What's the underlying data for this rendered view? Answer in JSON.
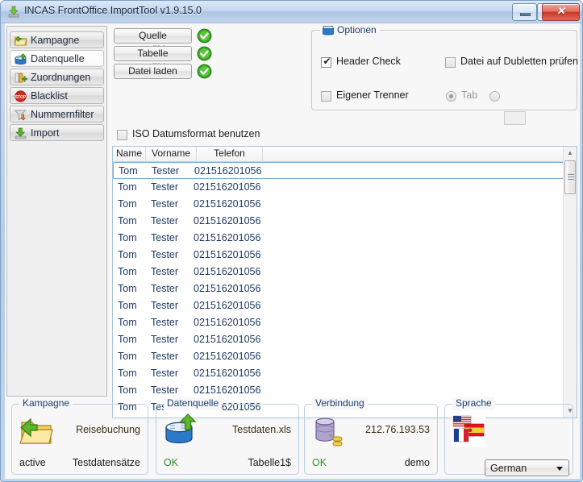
{
  "window": {
    "title": "INCAS FrontOffice ImportTool v1.9.15.0",
    "icon": "import-arrow-icon",
    "minimize_label": "",
    "maximize_label": "",
    "close_label": "✕"
  },
  "sidebar": {
    "items": [
      {
        "label": "Kampagne",
        "icon": "folder-arrow-icon",
        "selected": false
      },
      {
        "label": "Datenquelle",
        "icon": "database-arrow-icon",
        "selected": true
      },
      {
        "label": "Zuordnungen",
        "icon": "columns-plus-icon",
        "selected": false
      },
      {
        "label": "Blacklist",
        "icon": "stop-sign-icon",
        "selected": false
      },
      {
        "label": "Nummernfilter",
        "icon": "funnel-arrow-icon",
        "selected": false
      },
      {
        "label": "Import",
        "icon": "download-arrow-icon",
        "selected": false
      }
    ]
  },
  "toolbar": {
    "buttons": [
      {
        "label": "Quelle auswählen",
        "status_icon": "green-check-icon"
      },
      {
        "label": "Tabelle auswählen",
        "status_icon": "green-check-icon"
      },
      {
        "label": "Datei laden",
        "status_icon": "green-check-icon"
      }
    ]
  },
  "options": {
    "title": "Optionen",
    "icon": "options-box-icon",
    "header_check": {
      "label": "Header Check",
      "checked": true,
      "mark": "✔"
    },
    "duplicates_check": {
      "label": "Datei auf Dubletten prüfen",
      "checked": false
    },
    "own_separator": {
      "label": "Eigener Trenner",
      "checked": false
    },
    "separator_tab": {
      "label": "Tab",
      "selected": true
    },
    "separator_custom": {
      "label": "",
      "selected": false,
      "value": ""
    }
  },
  "iso_date": {
    "label": "ISO Datumsformat benutzen",
    "checked": false
  },
  "grid": {
    "columns": [
      {
        "label": "Name"
      },
      {
        "label": "Vorname"
      },
      {
        "label": "Telefon"
      },
      {
        "label": ""
      }
    ],
    "rows": [
      {
        "name": "Tom",
        "vorname": "Tester",
        "telefon": "021516201056",
        "selected": true
      },
      {
        "name": "Tom",
        "vorname": "Tester",
        "telefon": "021516201056",
        "selected": false
      },
      {
        "name": "Tom",
        "vorname": "Tester",
        "telefon": "021516201056",
        "selected": false
      },
      {
        "name": "Tom",
        "vorname": "Tester",
        "telefon": "021516201056",
        "selected": false
      },
      {
        "name": "Tom",
        "vorname": "Tester",
        "telefon": "021516201056",
        "selected": false
      },
      {
        "name": "Tom",
        "vorname": "Tester",
        "telefon": "021516201056",
        "selected": false
      },
      {
        "name": "Tom",
        "vorname": "Tester",
        "telefon": "021516201056",
        "selected": false
      },
      {
        "name": "Tom",
        "vorname": "Tester",
        "telefon": "021516201056",
        "selected": false
      },
      {
        "name": "Tom",
        "vorname": "Tester",
        "telefon": "021516201056",
        "selected": false
      },
      {
        "name": "Tom",
        "vorname": "Tester",
        "telefon": "021516201056",
        "selected": false
      },
      {
        "name": "Tom",
        "vorname": "Tester",
        "telefon": "021516201056",
        "selected": false
      },
      {
        "name": "Tom",
        "vorname": "Tester",
        "telefon": "021516201056",
        "selected": false
      },
      {
        "name": "Tom",
        "vorname": "Tester",
        "telefon": "021516201056",
        "selected": false
      },
      {
        "name": "Tom",
        "vorname": "Tester",
        "telefon": "021516201056",
        "selected": false
      },
      {
        "name": "Tom",
        "vorname": "Tester",
        "telefon": "021516201056",
        "selected": false
      }
    ],
    "scrollbar": {
      "up_glyph": "▲",
      "down_glyph": "▼"
    }
  },
  "status": {
    "kampagne": {
      "title": "Kampagne",
      "icon": "folder-arrow-icon",
      "name": "Reisebuchung",
      "state": "active",
      "detail": "Testdatensätze"
    },
    "datenquelle": {
      "title": "Datenquelle",
      "icon": "database-arrow-icon",
      "file": "Testdaten.xls",
      "state": "OK",
      "detail": "Tabelle1$"
    },
    "verbindung": {
      "title": "Verbindung",
      "icon": "database-plug-icon",
      "host": "212.76.193.53",
      "state": "OK",
      "detail": "demo"
    },
    "sprache": {
      "title": "Sprache",
      "icon": "flags-icon",
      "selected": "German"
    }
  },
  "colors": {
    "titlebar": "#c6d8ee",
    "accent_blue": "#1d3c6e",
    "ok_green": "#2f8a2f",
    "close_red": "#c8372a",
    "grid_text": "#1f3a63"
  }
}
